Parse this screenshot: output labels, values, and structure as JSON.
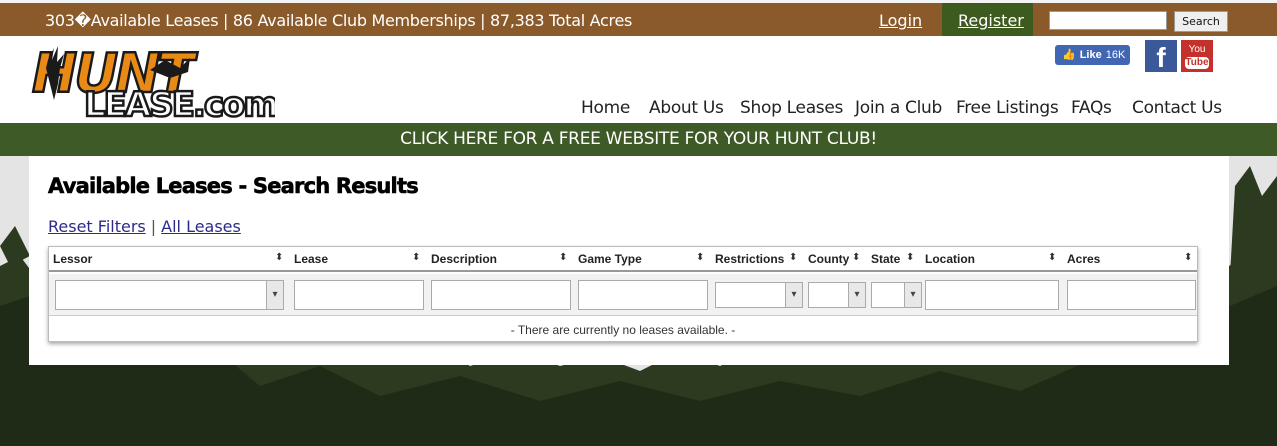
{
  "topbar": {
    "stats": "303�Available Leases | 86 Available Club Memberships | 87,383 Total Acres",
    "login_label": "Login",
    "register_label": "Register",
    "search_placeholder": "",
    "search_button": "Search"
  },
  "header": {
    "logo_text": "HUNT LEASE.com",
    "logo_top": "HUNT",
    "logo_bottom": "LEASE.com",
    "fb_like_label": "Like",
    "fb_like_count": "16K",
    "facebook_icon": "f",
    "youtube_top": "You",
    "youtube_bottom": "Tube"
  },
  "nav": {
    "items": [
      {
        "label": "Home"
      },
      {
        "label": "About Us"
      },
      {
        "label": "Shop Leases"
      },
      {
        "label": "Join a Club"
      },
      {
        "label": "Free Listings"
      },
      {
        "label": "FAQs"
      },
      {
        "label": "Contact Us"
      }
    ]
  },
  "promo": {
    "text": "CLICK HERE FOR A FREE WEBSITE FOR YOUR HUNT CLUB!"
  },
  "main": {
    "title": "Available Leases - Search Results",
    "reset_filters": "Reset Filters",
    "separator": "|",
    "all_leases": "All Leases",
    "table": {
      "columns": [
        "Lessor",
        "Lease",
        "Description",
        "Game Type",
        "Restrictions",
        "County",
        "State",
        "Location",
        "Acres"
      ],
      "sort_glyph": "⬍",
      "dropdown_glyph": "▾",
      "empty_message": "- There are currently no leases available. -"
    }
  },
  "colors": {
    "topbar": "#8b5a2b",
    "register_bg": "#3d5a1f",
    "promo_bg": "#3e5a27",
    "logo_orange": "#e98a16",
    "forest_dark": "#2c3a1f"
  }
}
